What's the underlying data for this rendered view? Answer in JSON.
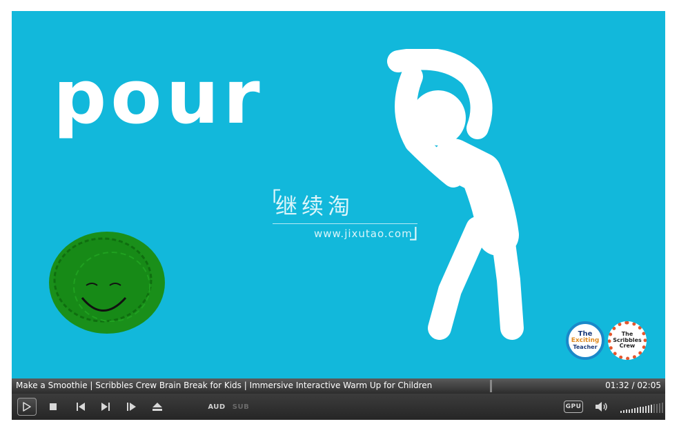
{
  "video": {
    "word": "pour",
    "watermark_cn": "继续淘",
    "watermark_url": "www.jixutao.com",
    "watermark_bracket_open": "「",
    "watermark_bracket_close": "」",
    "logo_exciting": {
      "line1": "The",
      "line2": "Exciting",
      "line3": "Teacher"
    },
    "logo_scribbles": {
      "line1": "The",
      "line2": "Scribbles",
      "line3": "Crew"
    },
    "background_color": "#12b8db"
  },
  "title_bar": {
    "title": "Make a Smoothie | Scribbles Crew Brain Break for Kids | Immersive Interactive Warm Up for Children",
    "time": "01:32 / 02:05"
  },
  "controls": {
    "play_icon": "play-icon",
    "stop_icon": "stop-icon",
    "prev_icon": "previous-icon",
    "next_icon": "next-icon",
    "frame_step_icon": "frame-step-icon",
    "eject_icon": "eject-icon",
    "aud_label": "AUD",
    "sub_label": "SUB",
    "gpu_label": "GPU",
    "speaker_icon": "speaker-icon",
    "volume_level": 0.7
  }
}
